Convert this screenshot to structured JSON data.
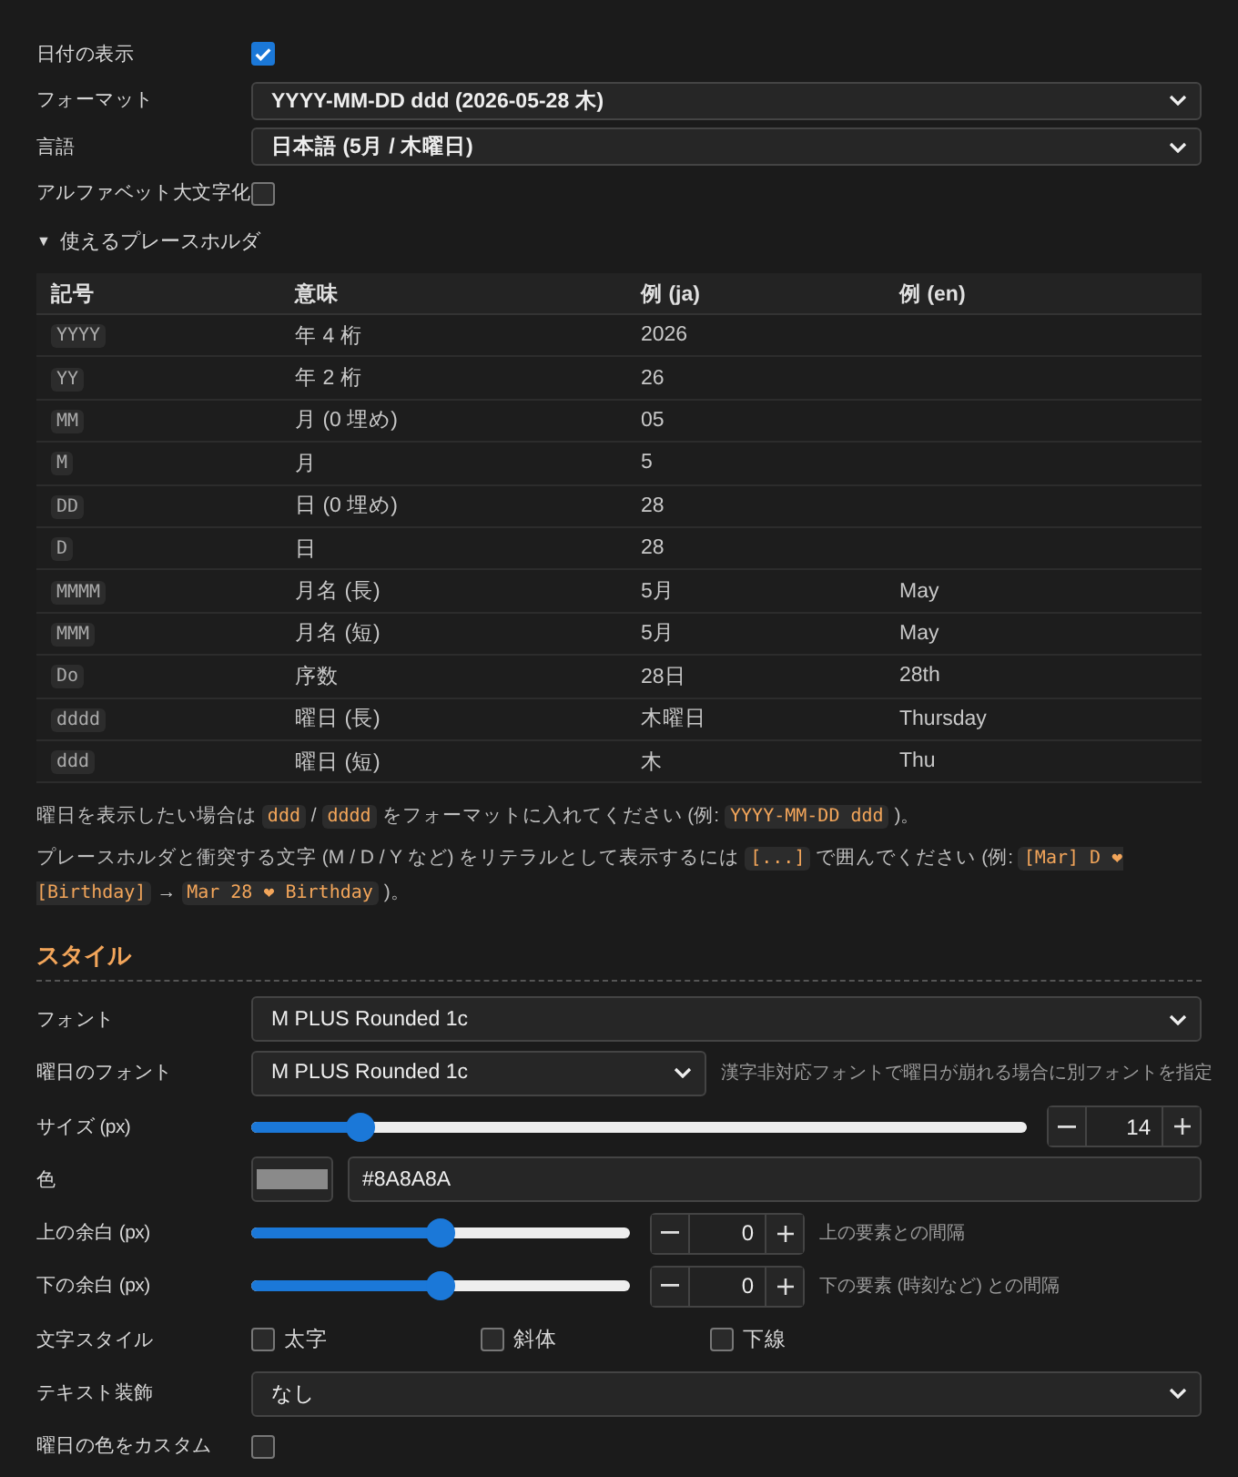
{
  "settings": [
    {
      "kind": "checkbox",
      "label": "日付の表示",
      "checked": true
    },
    {
      "kind": "select",
      "label": "フォーマット",
      "value": "YYYY-MM-DD ddd (2026-05-28 木)"
    },
    {
      "kind": "select",
      "label": "言語",
      "value": "日本語 (5月 / 木曜日)"
    },
    {
      "kind": "checkbox",
      "label": "アルファベット大文字化",
      "checked": false
    }
  ],
  "placeholders": {
    "toggle": "▼",
    "title": "使えるプレースホルダ",
    "columns": [
      "記号",
      "意味",
      "例 (ja)",
      "例 (en)"
    ],
    "rows": [
      {
        "symbol": "YYYY",
        "meaning": "年 4 桁",
        "ja": "2026"
      },
      {
        "symbol": "YY",
        "meaning": "年 2 桁",
        "ja": "26"
      },
      {
        "symbol": "MM",
        "meaning": "月 (0 埋め)",
        "ja": "05"
      },
      {
        "symbol": "M",
        "meaning": "月",
        "ja": "5"
      },
      {
        "symbol": "DD",
        "meaning": "日 (0 埋め)",
        "ja": "28"
      },
      {
        "symbol": "D",
        "meaning": "日",
        "ja": "28"
      },
      {
        "symbol": "MMMM",
        "meaning": "月名 (長)",
        "ja": "5月",
        "en": "May"
      },
      {
        "symbol": "MMM",
        "meaning": "月名 (短)",
        "ja": "5月",
        "en": "May"
      },
      {
        "symbol": "Do",
        "meaning": "序数",
        "ja": "28日",
        "en": "28th"
      },
      {
        "symbol": "dddd",
        "meaning": "曜日 (長)",
        "ja": "木曜日",
        "en": "Thursday"
      },
      {
        "symbol": "ddd",
        "meaning": "曜日 (短)",
        "ja": "木",
        "en": "Thu"
      }
    ]
  },
  "notes": [
    [
      {
        "kind": "text",
        "text": "曜日を表示したい場合は "
      },
      {
        "kind": "code",
        "text": "ddd"
      },
      {
        "kind": "text",
        "text": " / "
      },
      {
        "kind": "code",
        "text": "dddd"
      },
      {
        "kind": "text",
        "text": " をフォーマットに入れてください (例: "
      },
      {
        "kind": "code",
        "text": "YYYY-MM-DD ddd"
      },
      {
        "kind": "text",
        "text": " )。"
      }
    ],
    [
      {
        "kind": "text",
        "text": "プレースホルダと衝突する文字 (M / D / Y など) をリテラルとして表示するには "
      },
      {
        "kind": "code",
        "text": "[...]"
      },
      {
        "kind": "text",
        "text": " で囲んでください (例: "
      },
      {
        "kind": "code",
        "text": "[Mar] D ❤ [Birthday]"
      },
      {
        "kind": "text",
        "text": " → "
      },
      {
        "kind": "code",
        "text": "Mar 28 ❤ Birthday"
      },
      {
        "kind": "text",
        "text": " )。"
      }
    ]
  ],
  "style": {
    "title": "スタイル",
    "fields": [
      {
        "kind": "select",
        "label": "フォント",
        "value": "M PLUS Rounded 1c"
      },
      {
        "kind": "select",
        "label": "曜日のフォント",
        "value": "M PLUS Rounded 1c",
        "hint": "漢字非対応フォントで曜日が崩れる場合に別フォントを指定"
      },
      {
        "kind": "slider",
        "label": "サイズ (px)",
        "level": 0.14,
        "value": "14"
      },
      {
        "kind": "color",
        "label": "色",
        "value": "#8A8A8A"
      },
      {
        "kind": "slider",
        "label": "上の余白 (px)",
        "level": 0.5,
        "value": "0",
        "hint": "上の要素との間隔"
      },
      {
        "kind": "slider",
        "label": "下の余白 (px)",
        "level": 0.5,
        "value": "0",
        "hint": "下の要素 (時刻など) との間隔"
      },
      {
        "kind": "checkbox_group",
        "label": "文字スタイル",
        "options": [
          {
            "label": "太字",
            "checked": false
          },
          {
            "label": "斜体",
            "checked": false
          },
          {
            "label": "下線",
            "checked": false
          }
        ]
      },
      {
        "kind": "select",
        "label": "テキスト装飾",
        "value": "なし"
      },
      {
        "kind": "checkbox",
        "label": "曜日の色をカスタム",
        "checked": false
      }
    ]
  }
}
